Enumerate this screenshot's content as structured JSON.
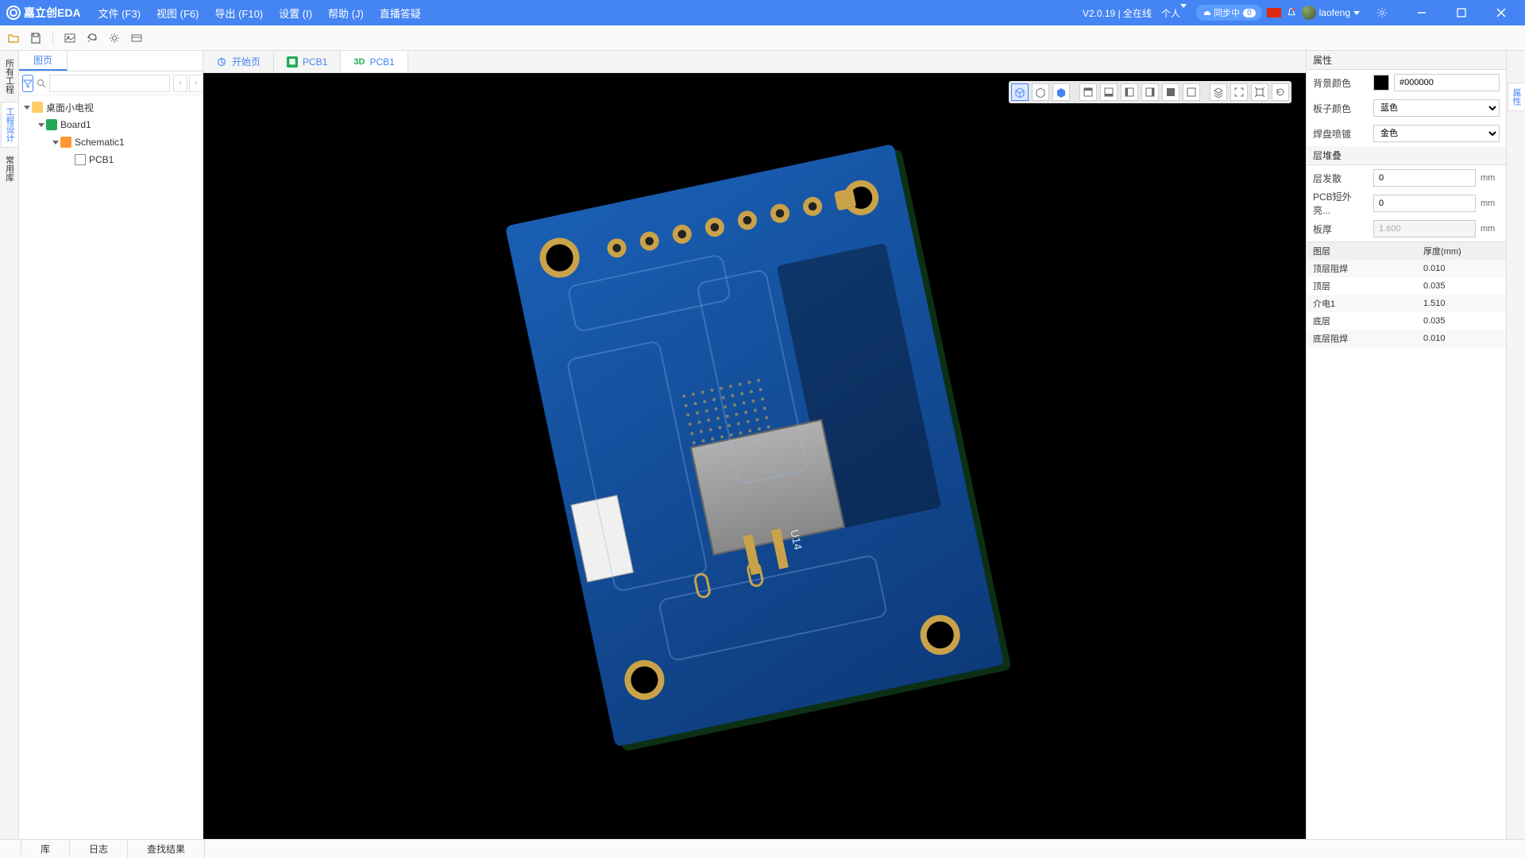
{
  "app": {
    "logo": "嘉立创EDA",
    "version": "V2.0.19",
    "status": "全在线",
    "account_type": "个人",
    "user": "laofeng"
  },
  "sync": {
    "label": "同步中",
    "count": "0"
  },
  "menus": [
    {
      "label": "文件 (F3)"
    },
    {
      "label": "视图 (F6)"
    },
    {
      "label": "导出 (F10)"
    },
    {
      "label": "设置 (I)"
    },
    {
      "label": "帮助 (J)"
    },
    {
      "label": "直播答疑"
    }
  ],
  "left_rail": [
    {
      "label": "所有工程"
    },
    {
      "label": "工程设计"
    },
    {
      "label": "常用库"
    }
  ],
  "left_panel": {
    "tab": "图页"
  },
  "tree": {
    "root": "桌面小电视",
    "board": "Board1",
    "sch": "Schematic1",
    "pcb": "PCB1"
  },
  "file_tabs": [
    {
      "label": "开始页",
      "kind": "home"
    },
    {
      "label": "PCB1",
      "kind": "pcb"
    },
    {
      "label": "PCB1",
      "kind": "3d",
      "active": true,
      "prefix": "3D"
    }
  ],
  "right_rail": {
    "label": "属性"
  },
  "props": {
    "header": "属性",
    "bg_label": "背景颜色",
    "bg_value": "#000000",
    "board_color_label": "板子颜色",
    "board_color_value": "蓝色",
    "pad_spray_label": "焊盘喷镀",
    "pad_spray_value": "金色",
    "stack_header": "层堆叠",
    "emissive_label": "层发散",
    "emissive_value": "0",
    "pcbshort_label": "PCB短外亮...",
    "pcbshort_value": "0",
    "thickness_label": "板厚",
    "thickness_value": "1.600",
    "unit": "mm",
    "layer_table": {
      "col1": "图层",
      "col2": "厚度(mm)",
      "rows": [
        {
          "name": "顶层阻焊",
          "val": "0.010"
        },
        {
          "name": "顶层",
          "val": "0.035"
        },
        {
          "name": "介电1",
          "val": "1.510"
        },
        {
          "name": "底层",
          "val": "0.035"
        },
        {
          "name": "底层阻焊",
          "val": "0.010"
        }
      ]
    }
  },
  "bottom_tabs": [
    {
      "label": "库"
    },
    {
      "label": "日志"
    },
    {
      "label": "查找结果"
    }
  ],
  "silk_text": "U14"
}
